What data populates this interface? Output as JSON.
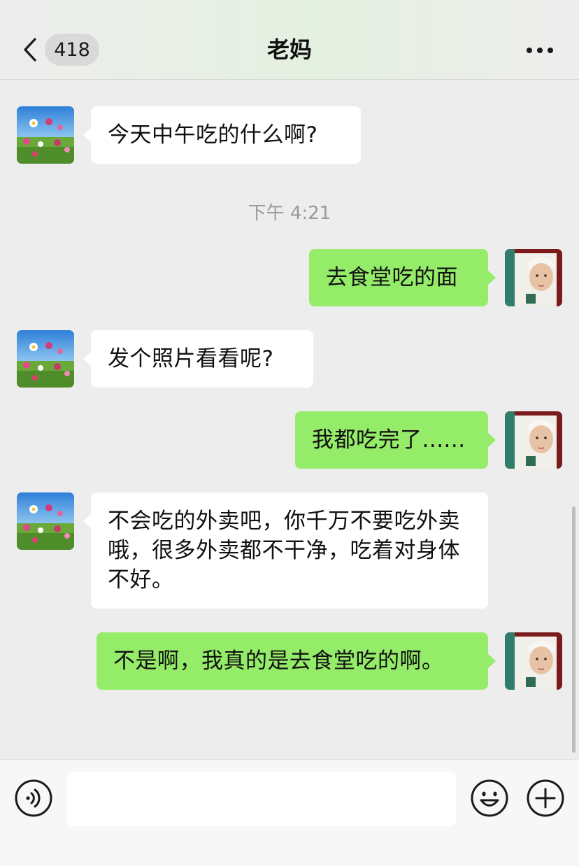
{
  "header": {
    "title": "老妈",
    "unread_count": "418",
    "back_icon": "chevron-left-icon",
    "more_icon": "more-dots-icon"
  },
  "messages": [
    {
      "side": "in",
      "text": "今天中午吃的什么啊?"
    },
    {
      "side": "out",
      "text": "去食堂吃的面"
    },
    {
      "side": "in",
      "text": "发个照片看看呢?"
    },
    {
      "side": "out",
      "text": "我都吃完了......"
    },
    {
      "side": "in",
      "text": "不会吃的外卖吧，你千万不要吃外卖哦，很多外卖都不干净，吃着对身体不好。"
    },
    {
      "side": "out",
      "text": "不是啊，我真的是去食堂吃的啊。"
    }
  ],
  "timestamp": "下午 4:21",
  "input_bar": {
    "placeholder": "",
    "voice_icon": "voice-icon",
    "emoji_icon": "emoji-icon",
    "plus_icon": "plus-icon"
  },
  "colors": {
    "outgoing_bubble": "#95ec69",
    "incoming_bubble": "#ffffff",
    "background": "#ededed"
  }
}
